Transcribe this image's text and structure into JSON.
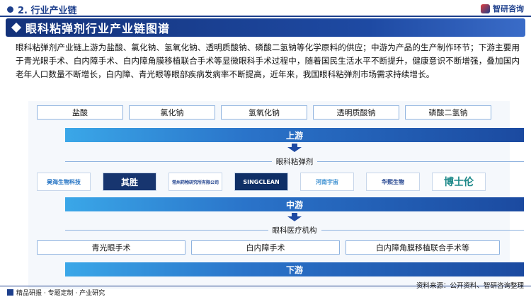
{
  "header": {
    "section_title": "2. 行业产业链",
    "brand": "智研咨询"
  },
  "banner": {
    "title": "眼科粘弹剂行业产业链图谱"
  },
  "description": "眼科粘弹剂产业链上游为盐酸、氯化钠、氢氧化钠、透明质酸钠、磷酸二氢钠等化学原料的供应；中游为产品的生产制作环节；下游主要用于青光眼手术、白内障手术、白内障角膜移植联合手术等显微眼科手术过程中，随着国民生活水平不断提升，健康意识不断增强，叠加国内老年人口数量不断增长，白内障、青光眼等眼部疾病发病率不断提高，近年来，我国眼科粘弹剂市场需求持续增长。",
  "upstream": {
    "items": [
      "盐酸",
      "氯化钠",
      "氢氧化钠",
      "透明质酸钠",
      "磷酸二氢钠"
    ],
    "label": "上游"
  },
  "midstream": {
    "group_label": "眼科粘弹剂",
    "logos": [
      {
        "icon": "company-logo-1",
        "text": "昊海生物科技"
      },
      {
        "icon": "company-logo-2",
        "text": "其胜"
      },
      {
        "icon": "company-logo-3",
        "text": "常州药物研究所有限公司"
      },
      {
        "icon": "company-logo-4",
        "text": "SINGCLEAN"
      },
      {
        "icon": "company-logo-5",
        "text": "河南宇宙"
      },
      {
        "icon": "company-logo-6",
        "text": "华熙生物"
      },
      {
        "icon": "company-logo-7",
        "text": "博士伦"
      }
    ],
    "label": "中游"
  },
  "downstream": {
    "group_label": "眼科医疗机构",
    "items": [
      "青光眼手术",
      "白内障手术",
      "白内障角膜移植联合手术等"
    ],
    "label": "下游"
  },
  "footer": {
    "left": "精品研报 · 专题定制 · 产业研究",
    "source": "资料来源：公开资料、智研咨询整理"
  },
  "colors": {
    "primary": "#1d3f8c",
    "stage_bar_start": "#3aa7e8",
    "stage_bar_end": "#1b4aa0",
    "box_border": "#8fb3df"
  }
}
